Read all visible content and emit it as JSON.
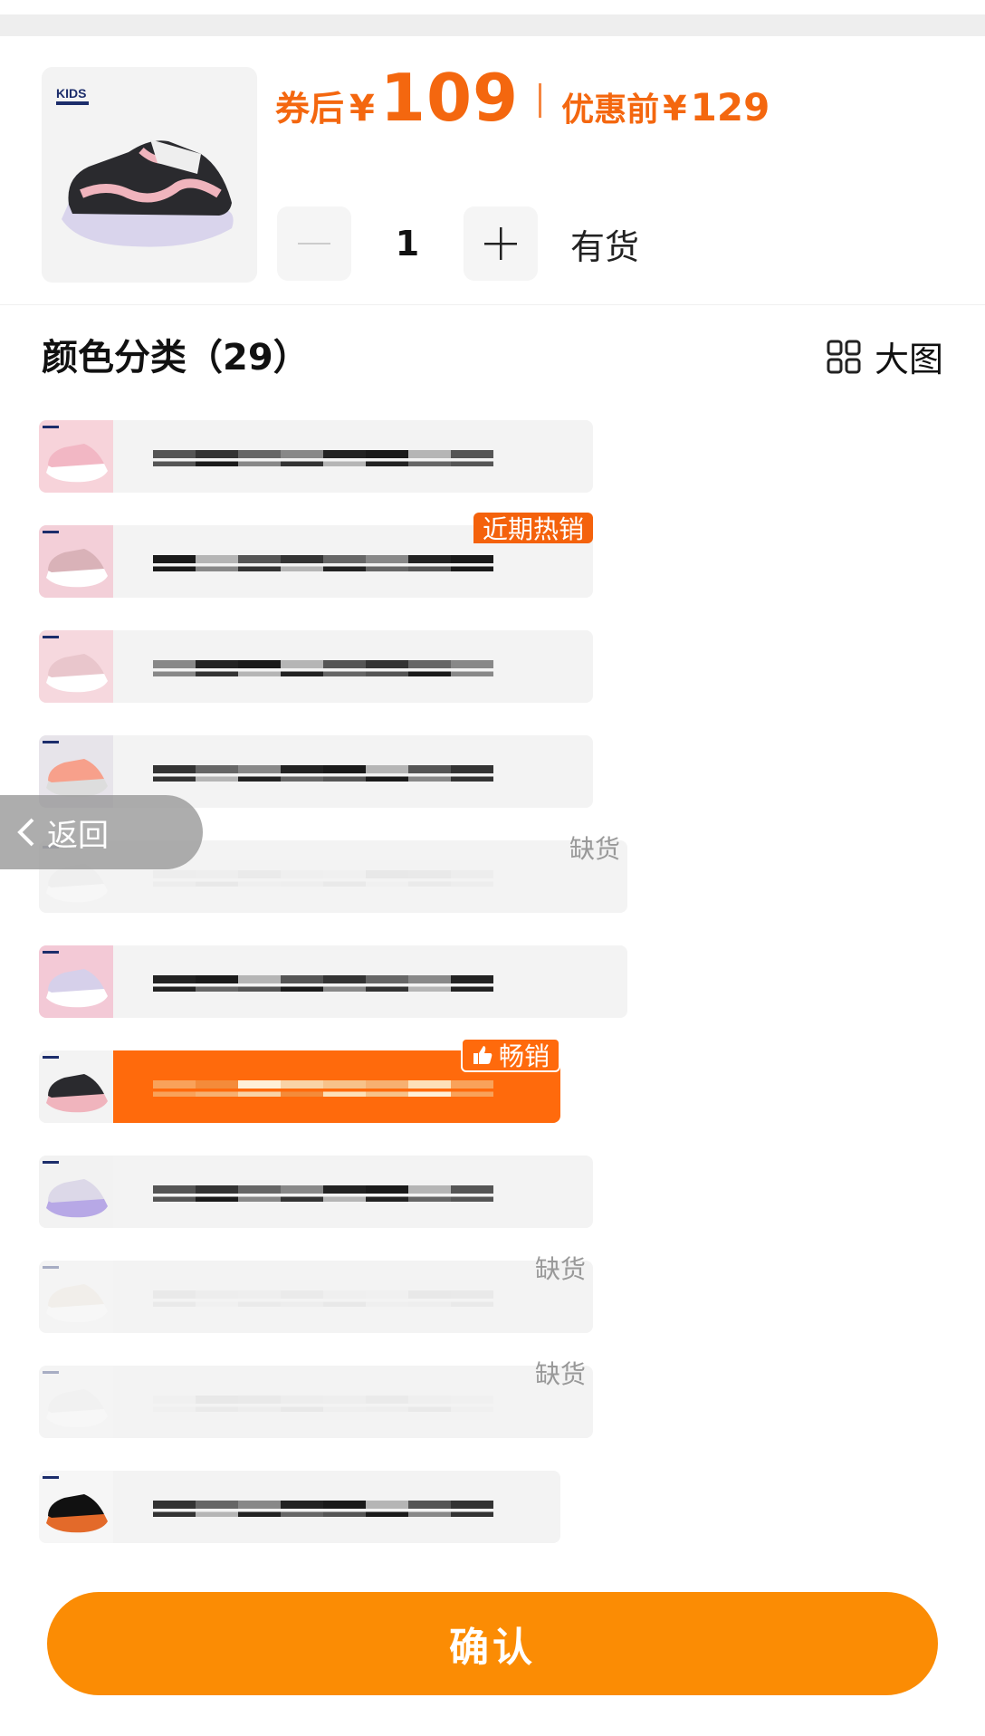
{
  "product": {
    "brand_logo": "KIDS",
    "after_coupon_label": "券后",
    "currency": "¥",
    "price_after": "109",
    "before_label": "优惠前",
    "price_before": "129"
  },
  "stepper": {
    "quantity": "1",
    "stock_status": "有货"
  },
  "section": {
    "title": "颜色分类（29）",
    "big_view_label": "大图"
  },
  "items": [
    {
      "tag": ""
    },
    {
      "tag": "近期热销"
    },
    {
      "tag": ""
    },
    {
      "tag": ""
    },
    {
      "tag": "缺货"
    },
    {
      "tag": ""
    },
    {
      "tag": "畅销"
    },
    {
      "tag": ""
    },
    {
      "tag": "缺货"
    },
    {
      "tag": "缺货"
    },
    {
      "tag": ""
    }
  ],
  "back_label": "返回",
  "confirm_label": "确认",
  "colors": {
    "accent": "#f4670f",
    "confirm": "#fb8c04",
    "selected": "#ff6a0c"
  }
}
